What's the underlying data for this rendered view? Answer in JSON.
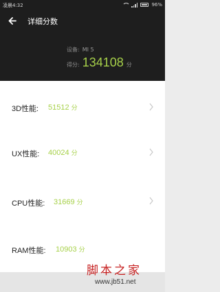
{
  "status_bar": {
    "time": "凌晨4:32",
    "battery": "96%"
  },
  "header": {
    "title": "详细分数",
    "device_label": "设备:",
    "device_value": "MI 5",
    "score_label": "得分:",
    "score_value": "134108",
    "score_unit": "分"
  },
  "scores": [
    {
      "label": "3D性能:",
      "value": "51512",
      "unit": "分",
      "has_chevron": true
    },
    {
      "label": "UX性能:",
      "value": "40024",
      "unit": "分",
      "has_chevron": true
    },
    {
      "label": "CPU性能:",
      "value": "31669",
      "unit": "分",
      "has_chevron": true
    },
    {
      "label": "RAM性能:",
      "value": "10903",
      "unit": "分",
      "has_chevron": false
    }
  ],
  "watermark": {
    "text": "脚本之家",
    "url": "www.jb51.net"
  },
  "colors": {
    "accent": "#a7d14a",
    "header_bg": "#1e1e1e",
    "page_bg": "#ececec"
  }
}
